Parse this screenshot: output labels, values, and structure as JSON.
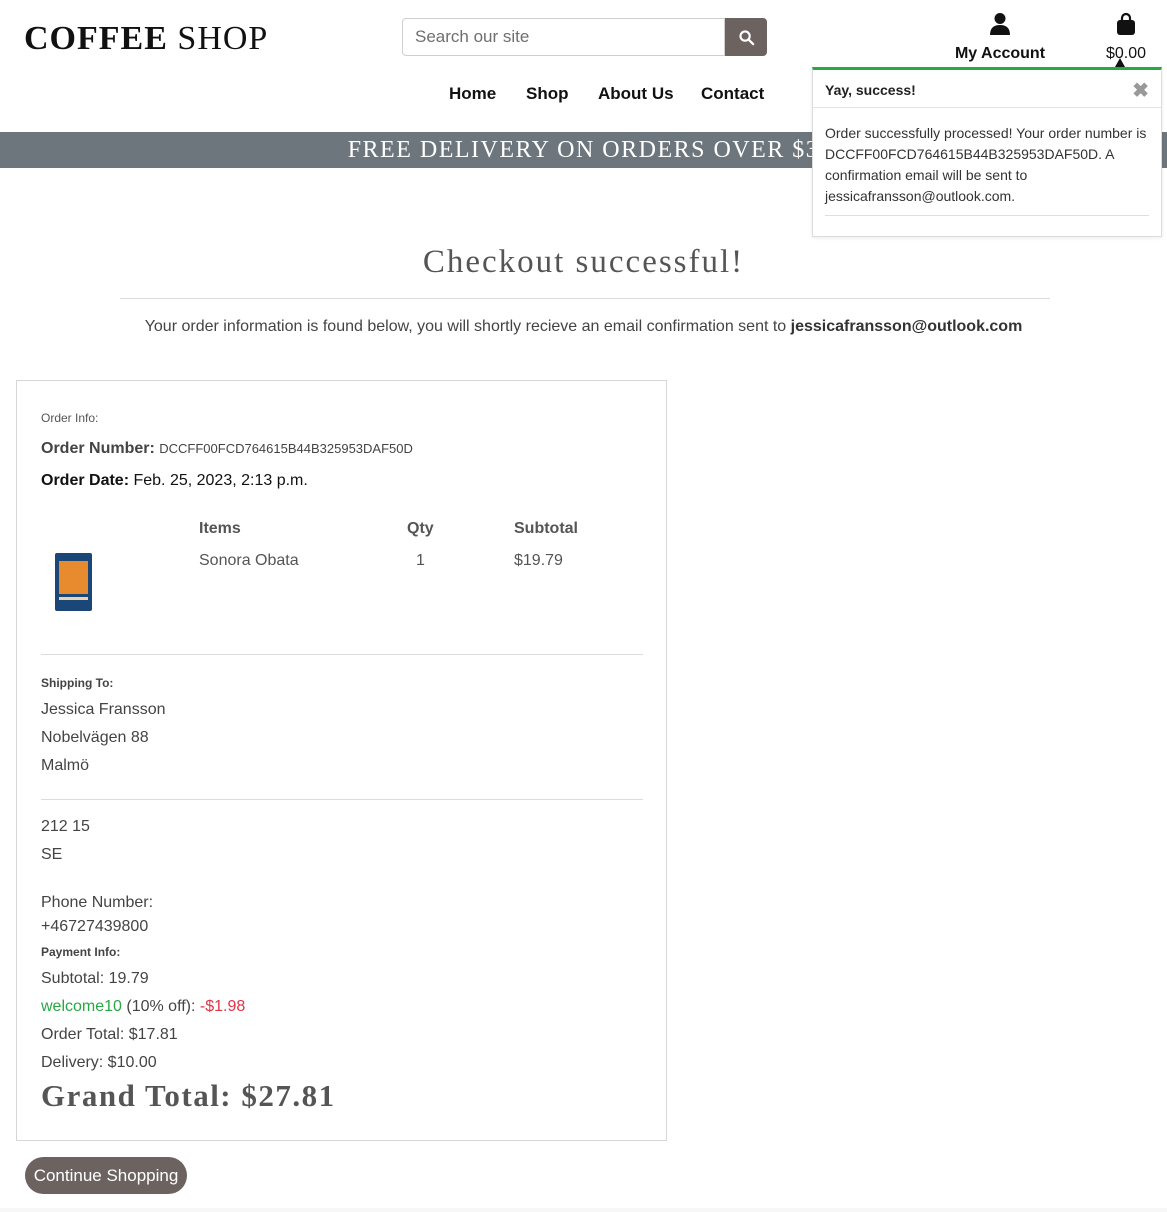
{
  "header": {
    "logo_bold": "COFFEE",
    "logo_light": "SHOP",
    "search_placeholder": "Search our site",
    "account_label": "My Account",
    "cart_amount": "$0.00",
    "icons": [
      "search-icon",
      "user-icon",
      "shopping-bag-icon"
    ]
  },
  "nav": {
    "items": [
      "Home",
      "Shop",
      "About Us",
      "Contact"
    ]
  },
  "banner": {
    "text": "FREE DELIVERY ON ORDERS OVER $3"
  },
  "toast": {
    "title": "Yay, success!",
    "close": "✖",
    "message": "Order successfully processed! Your order number is DCCFF00FCD764615B44B325953DAF50D. A confirmation email will be sent to jessicafransson@outlook.com.",
    "accent_color": "#28a745"
  },
  "page": {
    "title": "Checkout successful!",
    "intro_text": "Your order information is found below, you will shortly recieve an email confirmation sent to ",
    "intro_email": "jessicafransson@outlook.com"
  },
  "order": {
    "info_label": "Order Info:",
    "number_label": "Order Number:",
    "number_value": "DCCFF00FCD764615B44B325953DAF50D",
    "date_label": "Order Date:",
    "date_value": "Feb. 25, 2023, 2:13 p.m.",
    "columns": {
      "items": "Items",
      "qty": "Qty",
      "subtotal": "Subtotal"
    },
    "line_items": [
      {
        "name": "Sonora Obata",
        "qty": "1",
        "subtotal": "$19.79"
      }
    ]
  },
  "shipping": {
    "label": "Shipping To:",
    "name": "Jessica Fransson",
    "street": "Nobelvägen 88",
    "city": "Malmö",
    "postcode": "212 15",
    "country": "SE",
    "phone_label": "Phone Number:",
    "phone_value": "+46727439800"
  },
  "payment": {
    "label": "Payment Info:",
    "subtotal": "Subtotal: 19.79",
    "discount_code": "welcome10",
    "discount_desc": " (10% off): ",
    "discount_amount": "-$1.98",
    "order_total": "Order Total: $17.81",
    "delivery": "Delivery: $10.00",
    "grand_total": "Grand Total: $27.81",
    "code_color": "#28a745",
    "discount_color": "#dc3545"
  },
  "actions": {
    "continue_label": "Continue Shopping"
  }
}
